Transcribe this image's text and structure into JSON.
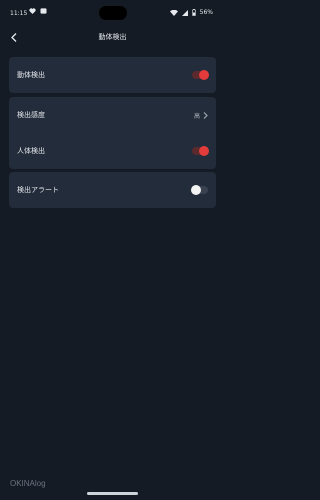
{
  "status": {
    "time": "11:15",
    "battery": "56%"
  },
  "header": {
    "title": "動体検出",
    "back_icon": "chevron-left-icon"
  },
  "settings": {
    "motion_detection": {
      "label": "動体検出",
      "enabled": true
    },
    "sensitivity": {
      "label": "検出感度",
      "value": "高"
    },
    "human_detection": {
      "label": "人体検出",
      "enabled": true
    },
    "detection_alert": {
      "label": "検出アラート",
      "enabled": false
    }
  },
  "watermark": "OKINAlog",
  "colors": {
    "background": "#151b24",
    "card": "#232c3a",
    "accent": "#e23b3b"
  }
}
